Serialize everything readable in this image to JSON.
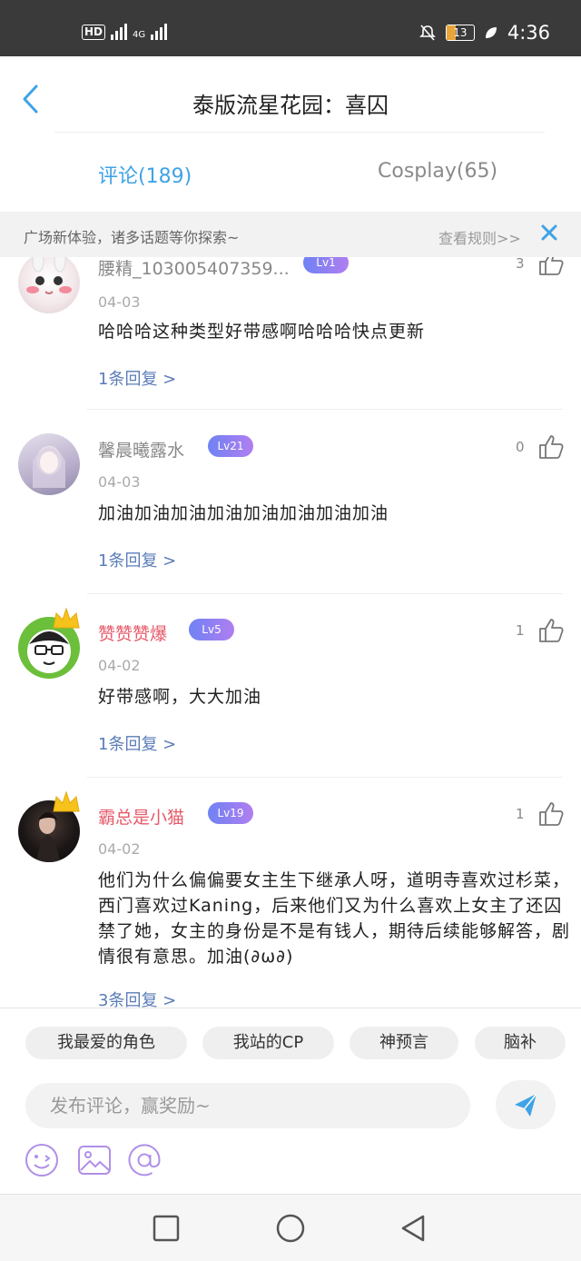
{
  "status_bar": {
    "hd_label": "HD",
    "network_label": "4G",
    "battery_level": "13",
    "time": "4:36"
  },
  "header": {
    "title": "泰版流星花园：喜囚"
  },
  "tabs": [
    {
      "label": "评论(189)",
      "active": true
    },
    {
      "label": "Cosplay(65)",
      "active": false
    }
  ],
  "notice": {
    "text": "广场新体验，诸多话题等你探索~",
    "rules_link": "查看规则>>"
  },
  "comments": [
    {
      "username": "腰精_103005407359...",
      "level": "Lv1",
      "likes": "3",
      "date": "04-03",
      "text": "哈哈哈这种类型好带感啊哈哈哈快点更新",
      "replies": "1条回复 >",
      "vip": false
    },
    {
      "username": "馨晨曦露水",
      "level": "Lv21",
      "likes": "0",
      "date": "04-03",
      "text": "加油加油加油加油加油加油加油加油",
      "replies": "1条回复 >",
      "vip": false
    },
    {
      "username": "赞赞赞爆",
      "level": "Lv5",
      "likes": "1",
      "date": "04-02",
      "text": "好带感啊，大大加油",
      "replies": "1条回复 >",
      "vip": true
    },
    {
      "username": "霸总是小猫",
      "level": "Lv19",
      "likes": "1",
      "date": "04-02",
      "text": "他们为什么偏偏要女主生下继承人呀，道明寺喜欢过杉菜，西门喜欢过Kaning，后来他们又为什么喜欢上女主了还囚禁了她，女主的身份是不是有钱人，期待后续能够解答，剧情很有意思。加油(∂ω∂)",
      "replies": "3条回复 >",
      "vip": true
    }
  ],
  "composer": {
    "chips": [
      "我最爱的角色",
      "我站的CP",
      "神预言",
      "脑补"
    ],
    "input_placeholder": "发布评论，赢奖励~"
  },
  "colors": {
    "accent": "#3fa3e6",
    "vip_name": "#e65a6a",
    "reply_link": "#5b7cb8",
    "level_badge": "#8f80f2"
  }
}
